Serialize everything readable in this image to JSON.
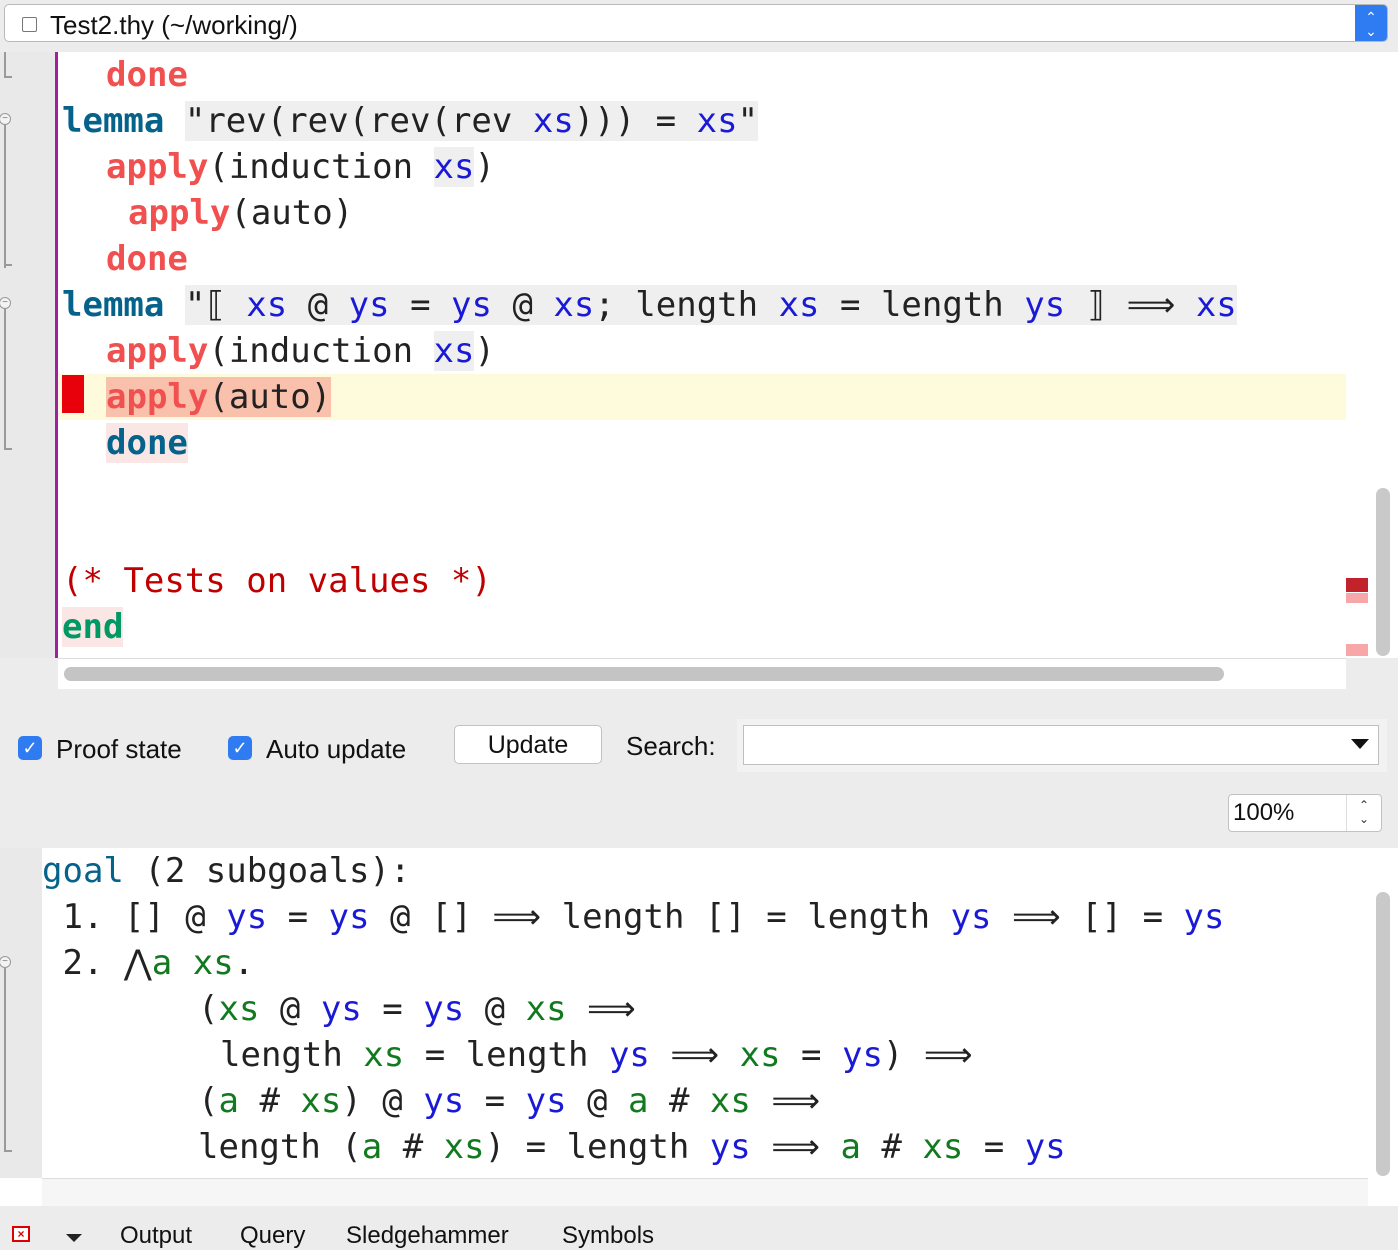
{
  "file_selector": {
    "title": "Test2.thy (~/working/)"
  },
  "editor": {
    "lines": [
      {
        "indent": "  ",
        "kw": "done"
      },
      {
        "kw": "lemma",
        "text": "\"rev(rev(rev(rev ",
        "var": "xs",
        "text2": "))) = ",
        "var2": "xs",
        "text3": "\""
      },
      {
        "kw": "apply",
        "text": "(induction ",
        "var": "xs",
        "text2": ")"
      },
      {
        "kw": "apply",
        "text": "(auto)"
      },
      {
        "kw": "done"
      },
      {
        "kw": "lemma",
        "open": "\"⟦ ",
        "v1": "xs",
        "t1": " @ ",
        "v2": "ys",
        "t2": " = ",
        "v3": "ys",
        "t3": " @ ",
        "v4": "xs",
        "t4": "; length ",
        "v5": "xs",
        "t5": " = length ",
        "v6": "ys",
        "t6": " ⟧ ⟹ ",
        "v7": "xs"
      },
      {
        "kw": "apply",
        "text": "(induction ",
        "var": "xs",
        "text2": ")"
      },
      {
        "kw": "apply",
        "text": "(auto)"
      },
      {
        "kw": "done"
      },
      {
        "comment": "(* Tests on values *)"
      },
      {
        "kw": "end"
      }
    ]
  },
  "toolbar": {
    "proof_state_label": "Proof state",
    "proof_state_checked": true,
    "auto_update_label": "Auto update",
    "auto_update_checked": true,
    "update_button": "Update",
    "search_label": "Search:",
    "search_value": "",
    "zoom": "100%"
  },
  "output": {
    "goal_kw": "goal",
    "goal_rest": " (2 subgoals):",
    "sub1": {
      "num": " 1. ",
      "a": "[] @ ",
      "v1": "ys",
      "b": " = ",
      "v2": "ys",
      "c": " @ [] ⟹ length [] = length ",
      "v3": "ys",
      "d": " ⟹ [] = ",
      "v4": "ys"
    },
    "sub2": {
      "num": " 2. ",
      "bind": "⋀",
      "bv": "a xs",
      "dot": "."
    }
  },
  "tabs": [
    "Output",
    "Query",
    "Sledgehammer",
    "Symbols"
  ],
  "colors": {
    "keyword_red": "#f0504f",
    "keyword_blue": "#05628a",
    "keyword_green": "#009966",
    "free_var": "#1a1ad6",
    "bound_var": "#117a1f",
    "comment": "#c00000",
    "accent": "#2f7bf2",
    "error": "#e8000b"
  }
}
